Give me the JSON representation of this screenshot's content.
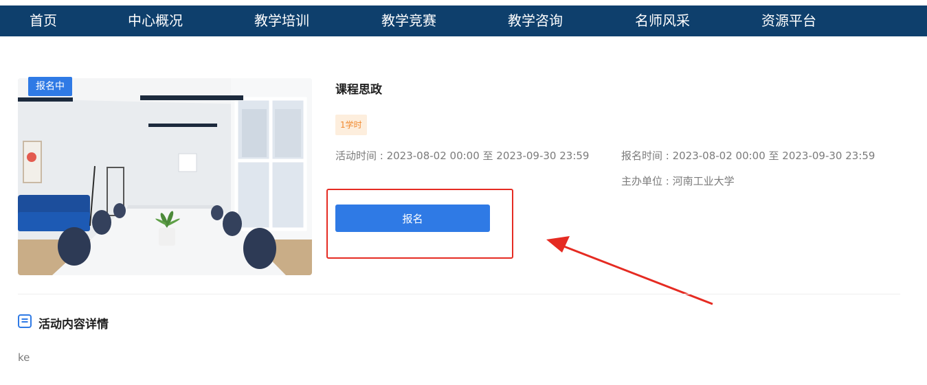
{
  "nav": {
    "items": [
      {
        "label": "首页"
      },
      {
        "label": "中心概况"
      },
      {
        "label": "教学培训"
      },
      {
        "label": "教学竞赛"
      },
      {
        "label": "教学咨询"
      },
      {
        "label": "名师风采"
      },
      {
        "label": "资源平台"
      }
    ]
  },
  "course": {
    "status_badge": "报名中",
    "title": "课程思政",
    "hours_tag": "1学时",
    "activity_time": "活动时间 : 2023-08-02 00:00 至 2023-09-30 23:59",
    "signup_time": "报名时间 : 2023-08-02 00:00 至 2023-09-30 23:59",
    "organizer": "主办单位 : 河南工业大学",
    "signup_button": "报名"
  },
  "detail": {
    "section_title": "活动内容详情",
    "content": "ke"
  },
  "colors": {
    "nav_bg": "#0e3f6c",
    "primary": "#2f7ae5",
    "annotation": "#e52b22",
    "tag_bg": "#fdeedd",
    "tag_text": "#f0892f"
  },
  "icons": {
    "section": "document-list-icon",
    "annotation": "arrow-pointer-icon"
  }
}
